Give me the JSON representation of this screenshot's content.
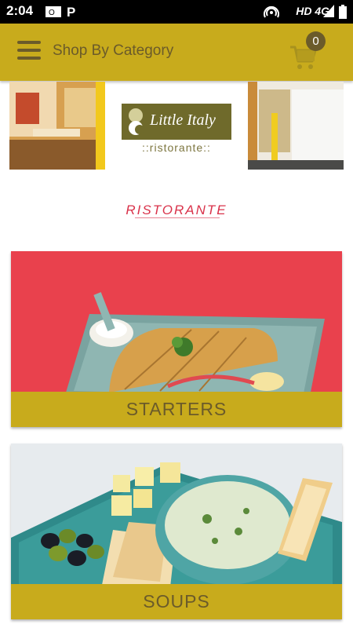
{
  "status_bar": {
    "time": "2:04",
    "network": "HD 4G"
  },
  "app_bar": {
    "title": "Shop By Category",
    "cart_count": "0"
  },
  "banner": {
    "logo_text": "Little Italy",
    "logo_subtext": "::ristorante::"
  },
  "section": {
    "heading": "RISTORANTE"
  },
  "categories": [
    {
      "label": "STARTERS"
    },
    {
      "label": "SOUPS"
    }
  ],
  "colors": {
    "accent": "#c8ab1c",
    "text_dark": "#6b5b2a",
    "heading_red": "#d9324a"
  },
  "icons": {
    "menu": "hamburger-menu-icon",
    "cart": "shopping-cart-icon"
  }
}
